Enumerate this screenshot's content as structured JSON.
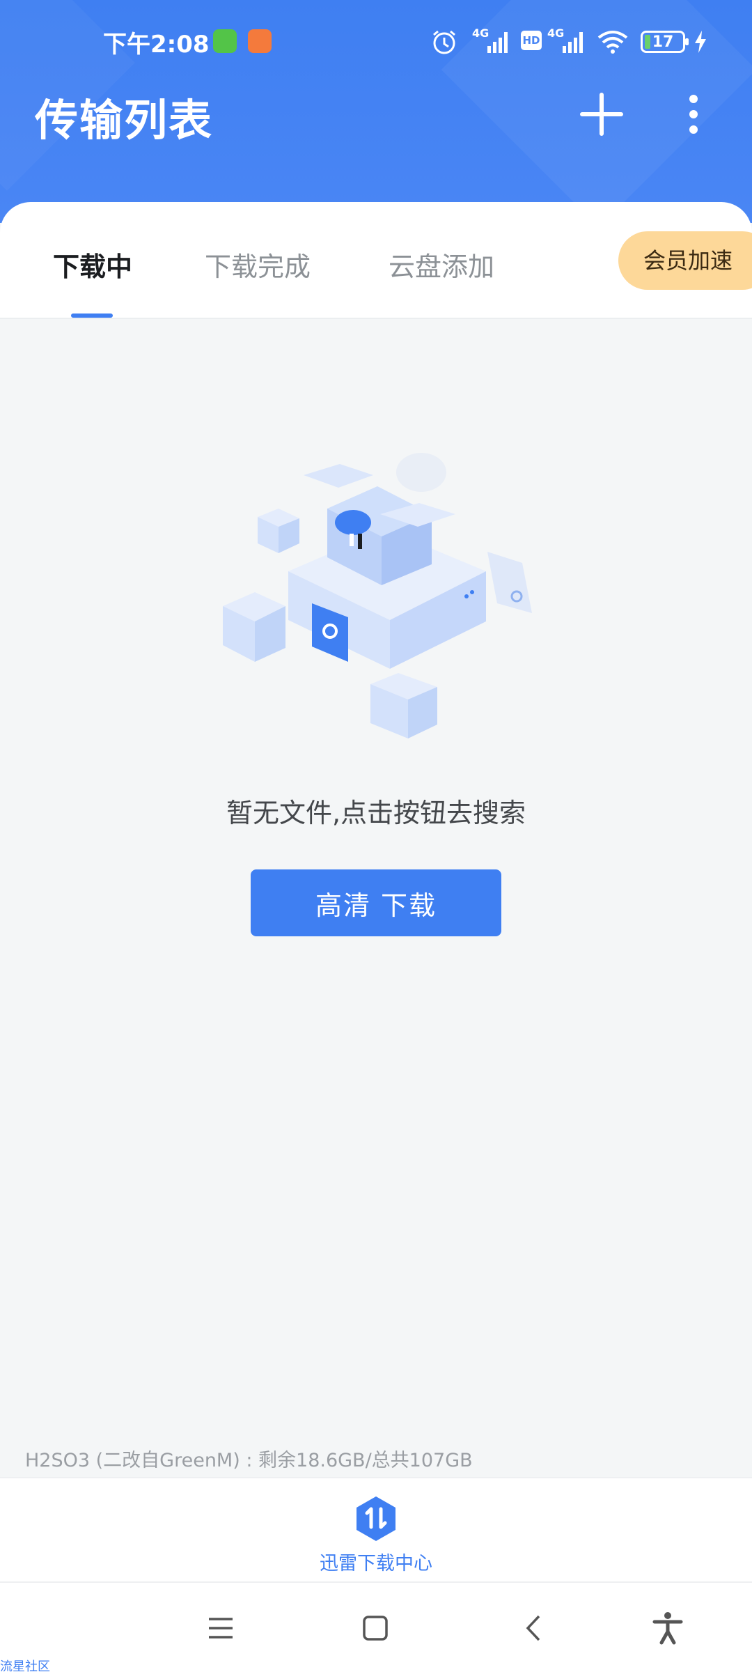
{
  "status_bar": {
    "time": "下午2:08",
    "network_1": "4G",
    "network_2": "4G",
    "hd_badge": "HD",
    "battery_level": "17",
    "icons": [
      "cat-app-icon",
      "shop-app-icon",
      "alarm-icon",
      "signal-icon",
      "hd-icon",
      "signal-icon",
      "wifi-icon",
      "battery-icon",
      "charging-icon"
    ]
  },
  "header": {
    "title": "传输列表",
    "add_icon": "plus-icon",
    "more_icon": "more-vertical-icon",
    "background_color": "#3f7ff2"
  },
  "tabs": [
    {
      "label": "下载中",
      "active": true
    },
    {
      "label": "下载完成",
      "active": false
    },
    {
      "label": "云盘添加",
      "active": false
    }
  ],
  "vip_button": {
    "label": "会员加速",
    "color": "#fdd899"
  },
  "empty_state": {
    "message": "暂无文件,点击按钮去搜索",
    "button_label": "高清 下载"
  },
  "storage": {
    "text": "H2SO3 (二改自GreenM) : 剩余18.6GB/总共107GB"
  },
  "bottom_nav": {
    "download_center_label": "迅雷下载中心",
    "icon": "transfer-hexagon-icon"
  },
  "system_nav": {
    "icons": [
      "menu-icon",
      "home-icon",
      "back-icon",
      "accessibility-icon"
    ]
  },
  "watermark": "流星社区"
}
